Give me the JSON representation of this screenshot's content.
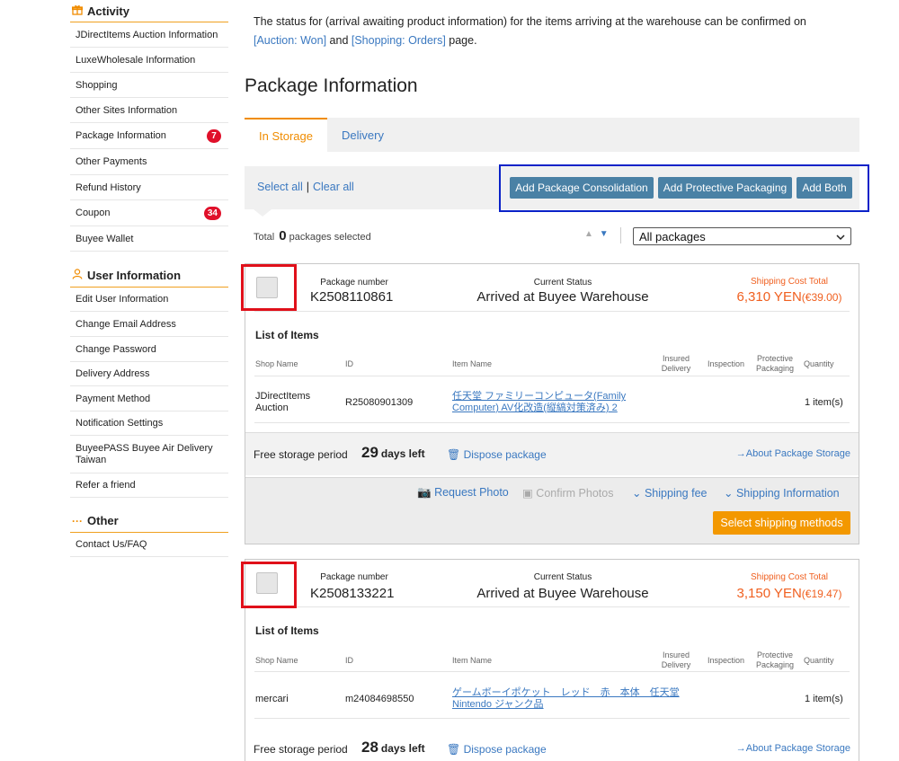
{
  "sidebar": {
    "activity_title": "Activity",
    "activity_items": [
      {
        "label": "JDirectItems Auction Information"
      },
      {
        "label": "LuxeWholesale Information"
      },
      {
        "label": "Shopping"
      },
      {
        "label": "Other Sites Information"
      },
      {
        "label": "Package Information",
        "badge": "7"
      },
      {
        "label": "Other Payments"
      },
      {
        "label": "Refund History"
      },
      {
        "label": "Coupon",
        "badge": "34"
      },
      {
        "label": "Buyee Wallet"
      }
    ],
    "user_title": "User Information",
    "user_items": [
      {
        "label": "Edit User Information"
      },
      {
        "label": "Change Email Address"
      },
      {
        "label": "Change Password"
      },
      {
        "label": "Delivery Address"
      },
      {
        "label": "Payment Method"
      },
      {
        "label": "Notification Settings"
      },
      {
        "label": "BuyeePASS Buyee Air Delivery Taiwan"
      },
      {
        "label": "Refer a friend"
      }
    ],
    "other_title": "Other",
    "other_items": [
      {
        "label": "Contact Us/FAQ"
      }
    ]
  },
  "notice": {
    "text_before": "The status for (arrival awaiting product information) for the items arriving at the warehouse can be confirmed on ",
    "link1": "[Auction: Won]",
    "text_mid": " and ",
    "link2": "[Shopping: Orders]",
    "text_after": " page."
  },
  "page_title": "Package Information",
  "tabs": [
    {
      "label": "In Storage",
      "active": true
    },
    {
      "label": "Delivery",
      "active": false
    }
  ],
  "toolbar": {
    "select_all": "Select all",
    "separator": "|",
    "clear_all": "Clear all",
    "btn_consolidation": "Add Package Consolidation",
    "btn_protective": "Add Protective Packaging",
    "btn_both": "Add Both"
  },
  "summary": {
    "total_label": "Total",
    "count": "0",
    "selected_label": "packages selected",
    "sort_up": "▲",
    "sort_down": "▼",
    "filter_value": "All packages"
  },
  "labels": {
    "package_number": "Package number",
    "current_status": "Current Status",
    "shipping_cost_total": "Shipping Cost Total",
    "list_of_items": "List of Items",
    "col_shop": "Shop Name",
    "col_id": "ID",
    "col_item": "Item Name",
    "col_insured_1": "Insured",
    "col_insured_2": "Delivery",
    "col_inspection": "Inspection",
    "col_protective_1": "Protective",
    "col_protective_2": "Packaging",
    "col_quantity": "Quantity",
    "free_storage": "Free storage period",
    "days_left": "days left",
    "dispose": "Dispose package",
    "about_storage": "→About Package Storage",
    "request_photo": "Request Photo",
    "confirm_photos": "Confirm Photos",
    "shipping_fee": "Shipping fee",
    "shipping_info": "Shipping Information",
    "select_shipping": "Select shipping methods"
  },
  "packages": [
    {
      "number": "K2508110861",
      "status": "Arrived at Buyee Warehouse",
      "cost": "6,310 YEN",
      "cost_eur": "(€39.00)",
      "shop_line1": "JDirectItems",
      "shop_line2": "Auction",
      "item_id": "R25080901309",
      "item_name_1": "任天堂 ファミリーコンピュータ(Family",
      "item_name_2": "Computer) AV化改造(縦縞対策済み) 2",
      "quantity": "1 item(s)",
      "days": "29"
    },
    {
      "number": "K2508133221",
      "status": "Arrived at Buyee Warehouse",
      "cost": "3,150 YEN",
      "cost_eur": "(€19.47)",
      "shop_line1": "mercari",
      "shop_line2": "",
      "item_id": "m24084698550",
      "item_name_1": "ゲームボーイポケット　レッド　赤　本体　任天堂",
      "item_name_2": "Nintendo ジャンク品",
      "quantity": "1 item(s)",
      "days": "28"
    }
  ]
}
